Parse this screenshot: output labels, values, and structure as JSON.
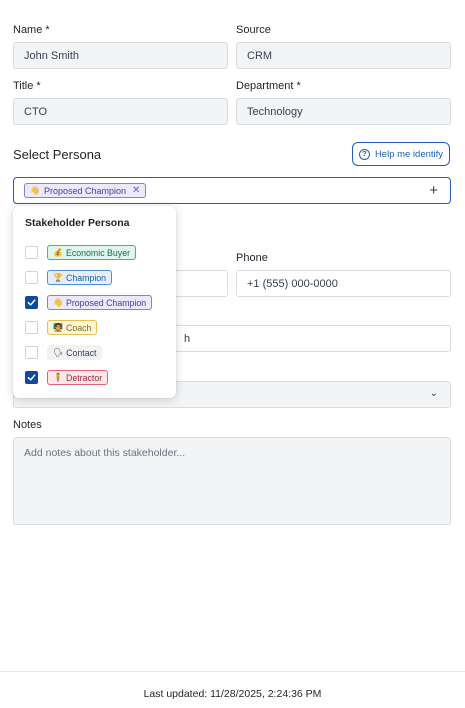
{
  "form": {
    "name": {
      "label": "Name *",
      "value": "John Smith"
    },
    "source": {
      "label": "Source",
      "value": "CRM"
    },
    "title": {
      "label": "Title *",
      "value": "CTO"
    },
    "department": {
      "label": "Department *",
      "value": "Technology"
    },
    "phone": {
      "label": "Phone",
      "placeholder": "+1 (555) 000-0000"
    },
    "hidden_field_tail": "h",
    "notes": {
      "label": "Notes",
      "placeholder": "Add notes about this stakeholder..."
    }
  },
  "persona": {
    "section_title": "Select Persona",
    "help_button_label": "Help me identify",
    "selected_chip": {
      "label": "Proposed Champion",
      "icon": "hand-wave-icon"
    },
    "dropdown": {
      "title": "Stakeholder Persona",
      "options": [
        {
          "label": "Economic Buyer",
          "icon": "money-bag-icon",
          "checked": false,
          "bg": "#dff5ee",
          "border": "#3fb78a",
          "fg": "#1d6b4f",
          "emoji": "💰"
        },
        {
          "label": "Champion",
          "icon": "trophy-icon",
          "checked": false,
          "bg": "#e3f0fc",
          "border": "#4a90d9",
          "fg": "#1d5ca0",
          "emoji": "🏆"
        },
        {
          "label": "Proposed Champion",
          "icon": "hand-wave-icon",
          "checked": true,
          "bg": "#ece9fb",
          "border": "#8b7cd8",
          "fg": "#4a3aa8",
          "emoji": "👋"
        },
        {
          "label": "Coach",
          "icon": "chalkboard-teacher-icon",
          "checked": false,
          "bg": "#fff6dc",
          "border": "#e8c04a",
          "fg": "#8a6a10",
          "emoji": "🧑‍🏫"
        },
        {
          "label": "Contact",
          "icon": "speech-icon",
          "checked": false,
          "bg": "#f1f2f4",
          "border": "#f1f2f4",
          "fg": "#374151",
          "emoji": "🗣"
        },
        {
          "label": "Detractor",
          "icon": "person-icon",
          "checked": true,
          "bg": "#fde7ea",
          "border": "#e06474",
          "fg": "#a3273a",
          "emoji": "🧍"
        }
      ]
    }
  },
  "footer": {
    "last_updated": "Last updated: 11/28/2025, 2:24:36 PM"
  },
  "colors": {
    "accent": "#1d5fb8",
    "checkbox_checked": "#0f4aa0"
  }
}
